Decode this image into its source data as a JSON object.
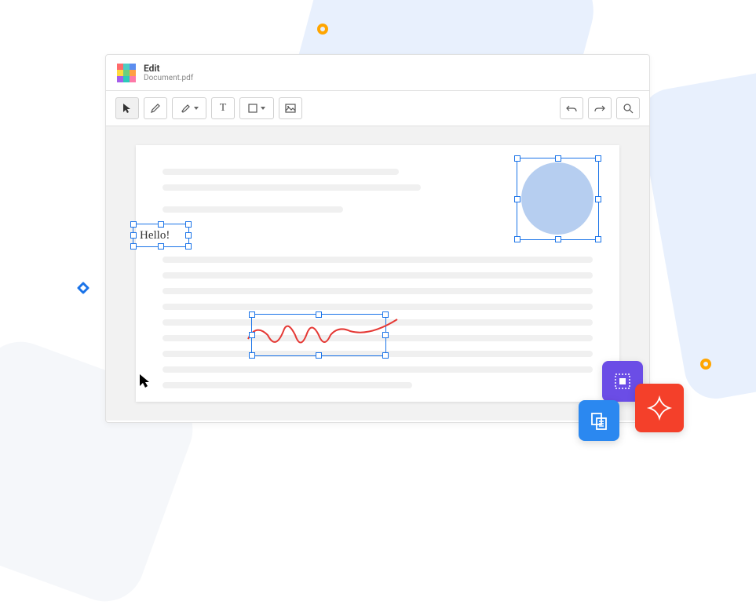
{
  "header": {
    "title": "Edit",
    "filename": "Document.pdf"
  },
  "toolbar": {
    "select": "select",
    "draw": "draw",
    "highlight": "highlight",
    "text": "text",
    "shape": "shape",
    "image": "image",
    "undo": "undo",
    "redo": "redo",
    "search": "search"
  },
  "canvas": {
    "text_annotation": "Hello!",
    "objects": [
      "circle",
      "text-box",
      "scribble"
    ]
  },
  "tiles": {
    "select_all": "select-all",
    "copy": "copy",
    "star_shape": "star-shape"
  }
}
